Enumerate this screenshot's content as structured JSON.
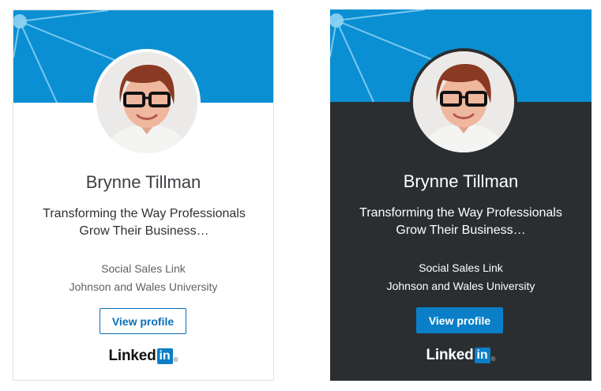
{
  "cards": [
    {
      "theme": "light",
      "name": "Brynne Tillman",
      "headline": "Transforming the Way Professionals Grow Their Business…",
      "company": "Social Sales Link",
      "school": "Johnson and Wales University",
      "button_label": "View profile",
      "brand_word": "Linked",
      "brand_in": "in",
      "brand_reg": "®"
    },
    {
      "theme": "dark",
      "name": "Brynne Tillman",
      "headline": "Transforming the Way Professionals Grow Their Business…",
      "company": "Social Sales Link",
      "school": "Johnson and Wales University",
      "button_label": "View profile",
      "brand_word": "Linked",
      "brand_in": "in",
      "brand_reg": "®"
    }
  ],
  "colors": {
    "banner": "#0b8fd3",
    "dark_background": "#2b2e31",
    "button_blue": "#0a7fc8",
    "link_blue": "#0a6fb8"
  }
}
